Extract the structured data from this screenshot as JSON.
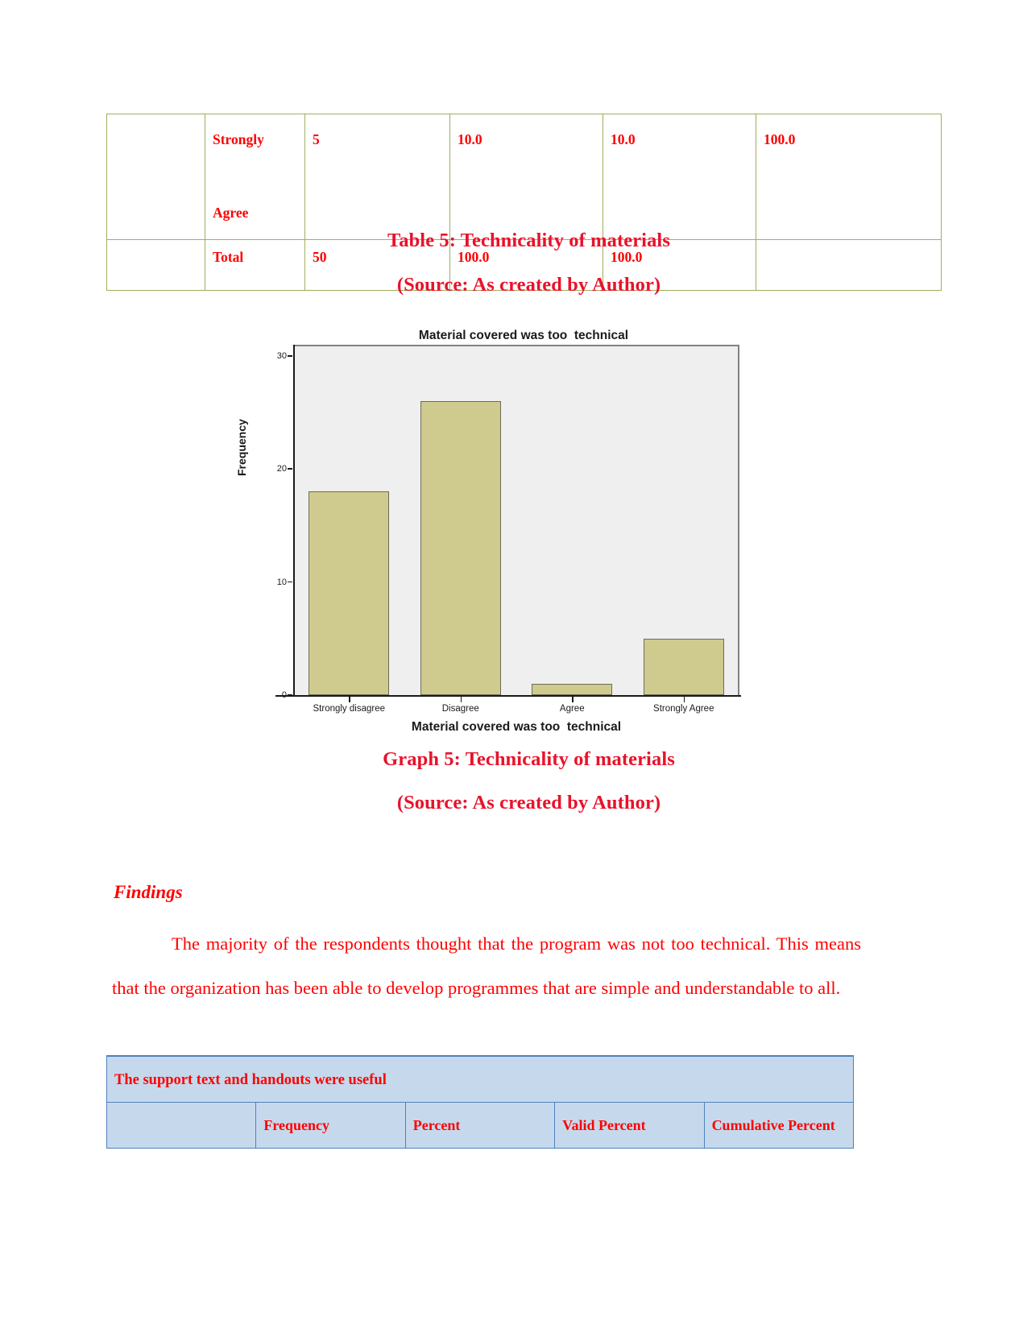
{
  "top_table": {
    "border_color": "#a2ad5c",
    "text_color": "#ff0000",
    "rows": [
      {
        "label": "Strongly\n\nAgree",
        "frequency": "5",
        "percent": "10.0",
        "valid_percent": "10.0",
        "cumulative_percent": "100.0"
      },
      {
        "label": "Total",
        "frequency": "50",
        "percent": "100.0",
        "valid_percent": "100.0",
        "cumulative_percent": ""
      }
    ],
    "row1_label_line1": "Strongly",
    "row1_label_line2": "Agree",
    "row2_label": "Total"
  },
  "captions": {
    "table5": "Table 5: Technicality of materials",
    "source1": "(Source: As created by Author)",
    "graph5": "Graph 5: Technicality of materials",
    "source2": "(Source: As created by Author)",
    "color": "#e8122a"
  },
  "chart_data": {
    "type": "bar",
    "title": "Material covered was too  technical",
    "xlabel": "Material covered was too  technical",
    "ylabel": "Frequency",
    "categories": [
      "Strongly disagree",
      "Disagree",
      "Agree",
      "Strongly Agree"
    ],
    "values": [
      18,
      26,
      1,
      5
    ],
    "ylim": [
      0,
      31
    ],
    "yticks": [
      0,
      10,
      20,
      30
    ],
    "ytick_labels": [
      "0",
      "10",
      "20",
      "30"
    ],
    "grid": false,
    "legend": "none",
    "bar_fill": "#cfcb8e",
    "bar_border": "#6c6c58",
    "plot_background": "#efefef"
  },
  "findings": {
    "heading": "Findings",
    "paragraph": "The majority of the respondents thought that the program was not too technical. This means that the organization has been able to develop programmes that are simple and understandable to all."
  },
  "bottom_table": {
    "title": "The support text and handouts were useful",
    "border_color": "#4f81bd",
    "fill_color": "#c6d9ec",
    "text_color": "#ff0000",
    "headers": [
      "",
      "Frequency",
      "Percent",
      "Valid Percent",
      "Cumulative Percent"
    ]
  }
}
